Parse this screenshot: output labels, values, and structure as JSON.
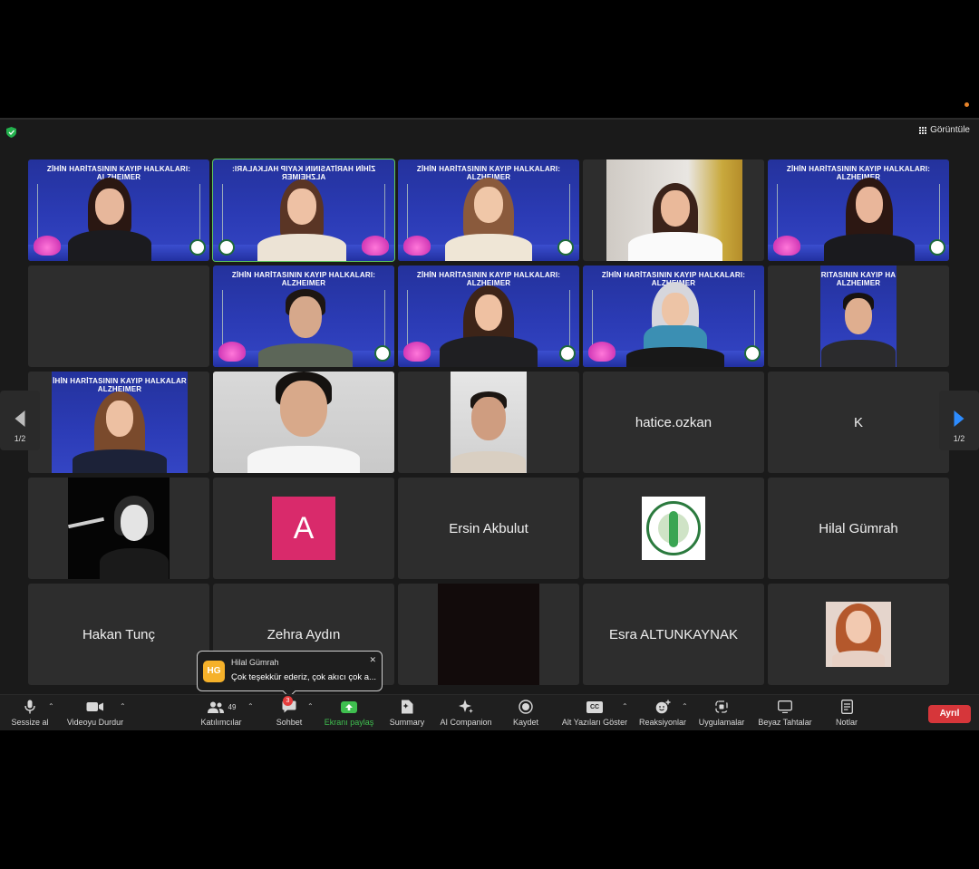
{
  "top": {
    "view_label": "Görüntüle"
  },
  "banner_text": {
    "full": "ZİHİN HARİTASININ KAYIP HALKALARI:",
    "second": "ALZHEIMER",
    "mirrored": "ZİHİN HARİTASININ KAYIP HALKALARI:",
    "partial_right": "RITASININ KAYIP HA",
    "partial_left": "İHİN HARİTASININ KAYIP HALKALAR"
  },
  "tiles": {
    "hatice": "hatice.ozkan",
    "k": "K",
    "avatar_a": "A",
    "ersin": "Ersin Akbulut",
    "hilal": "Hilal Gümrah",
    "hakan": "Hakan Tunç",
    "zehra": "Zehra Aydın",
    "esra": "Esra ALTUNKAYNAK"
  },
  "pagination": {
    "left": "1/2",
    "right": "1/2"
  },
  "toolbar": {
    "mute": "Sessize al",
    "video": "Videoyu Durdur",
    "participants": "Katılımcılar",
    "participants_count": "49",
    "chat": "Sohbet",
    "chat_badge": "3",
    "share": "Ekranı paylaş",
    "summary": "Summary",
    "companion": "AI Companion",
    "record": "Kaydet",
    "captions": "Alt Yazıları Göster",
    "captions_icon": "CC",
    "reactions": "Reaksiyonlar",
    "apps": "Uygulamalar",
    "whiteboard": "Beyaz Tahtalar",
    "notes": "Notlar",
    "leave": "Ayrıl"
  },
  "toast": {
    "initials": "HG",
    "sender": "Hilal Gümrah",
    "message": "Çok teşekkür ederiz, çok akıcı çok a..."
  },
  "colors": {
    "share_green": "#3fbf4f",
    "leave_red": "#d6363a",
    "accent_blue": "#2d8cff",
    "active_speaker": "#5ec95c"
  }
}
